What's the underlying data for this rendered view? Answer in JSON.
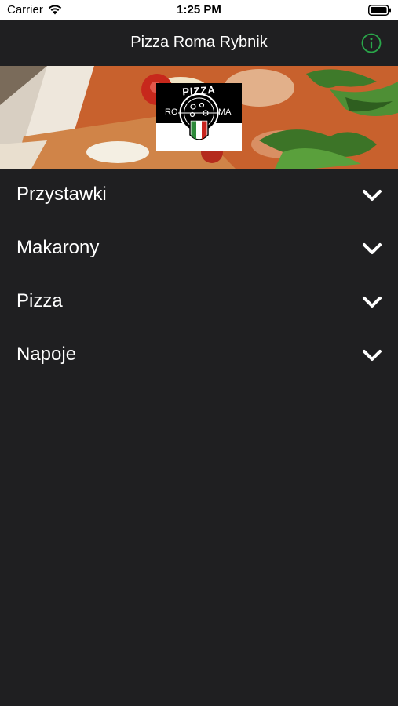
{
  "status_bar": {
    "carrier": "Carrier",
    "time": "1:25 PM",
    "icons": [
      "wifi-icon",
      "battery-icon"
    ]
  },
  "nav": {
    "title": "Pizza Roma Rybnik",
    "info_icon": "info-circle-icon",
    "accent_color": "#2aa84a"
  },
  "hero": {
    "logo": {
      "top_text": "PIZZA",
      "left_text": "RO",
      "right_text": "MA"
    }
  },
  "menu": {
    "categories": [
      {
        "label": "Przystawki",
        "icon": "chevron-down-icon"
      },
      {
        "label": "Makarony",
        "icon": "chevron-down-icon"
      },
      {
        "label": "Pizza",
        "icon": "chevron-down-icon"
      },
      {
        "label": "Napoje",
        "icon": "chevron-down-icon"
      }
    ]
  },
  "colors": {
    "background": "#1f1f21",
    "text": "#ffffff"
  }
}
